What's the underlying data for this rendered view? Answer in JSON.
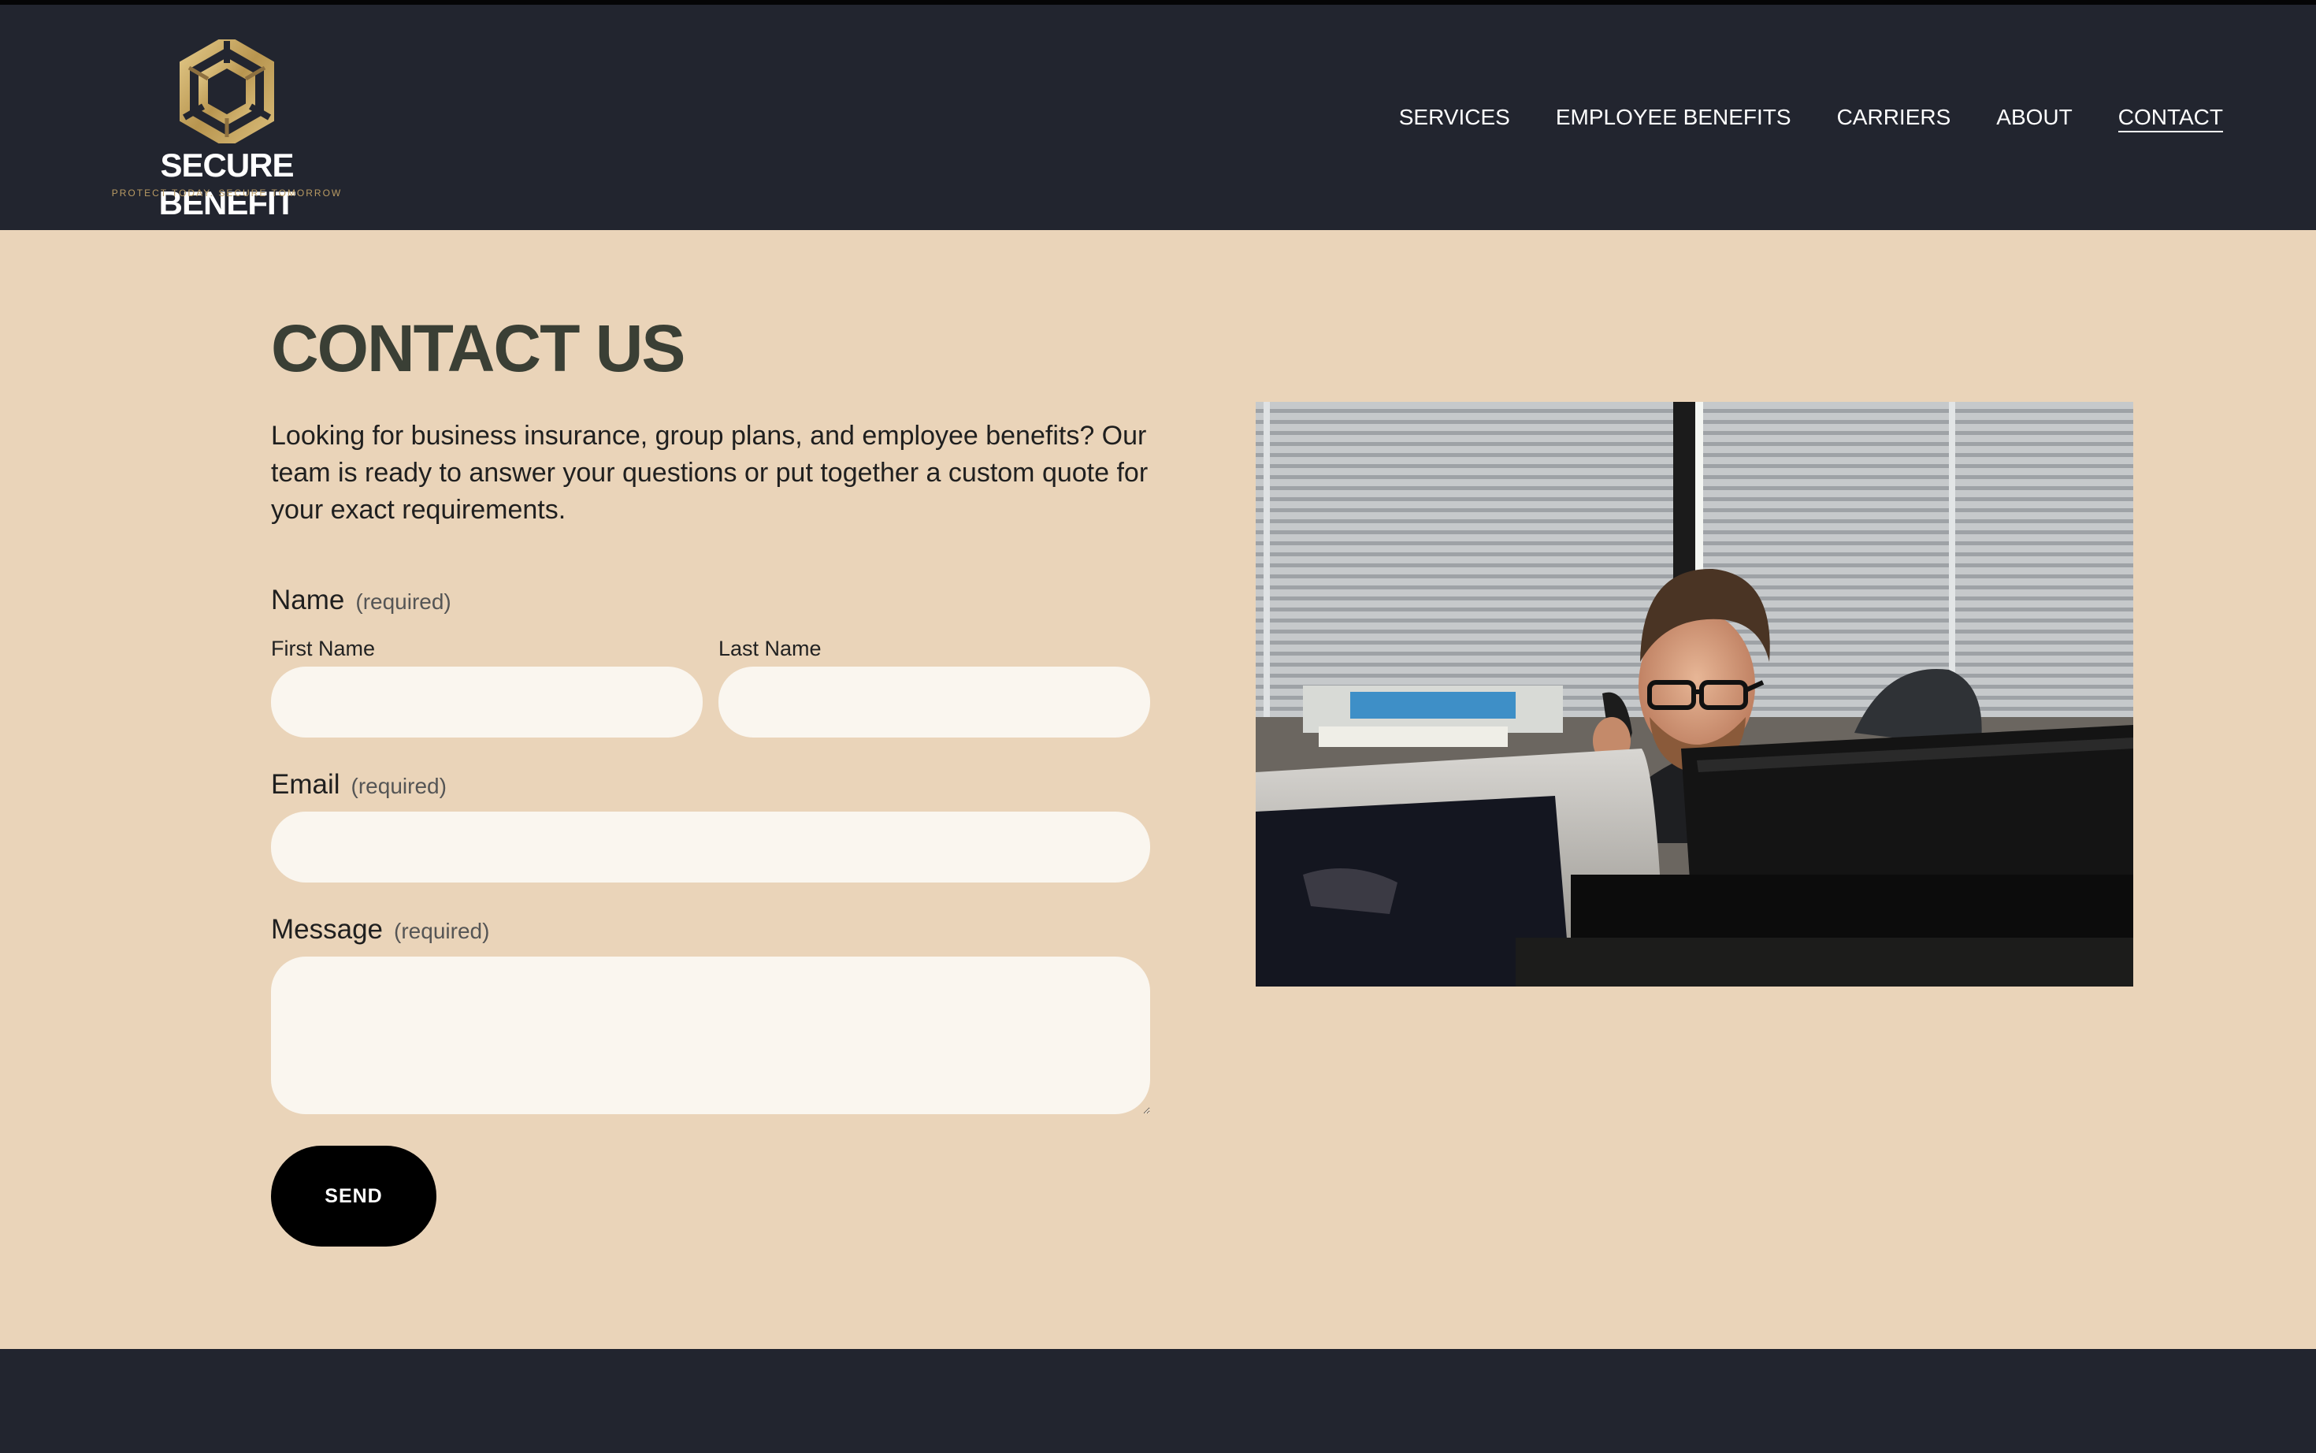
{
  "brand": {
    "name": "SECURE BENEFIT",
    "tagline": "PROTECT TODAY. SECURE TOMORROW",
    "logo_icon": "hexagon-knot-icon",
    "accent_color": "#c9a862"
  },
  "nav": {
    "items": [
      {
        "label": "SERVICES"
      },
      {
        "label": "EMPLOYEE BENEFITS"
      },
      {
        "label": "CARRIERS"
      },
      {
        "label": "ABOUT"
      },
      {
        "label": "CONTACT",
        "active": true
      }
    ]
  },
  "page": {
    "title": "CONTACT US",
    "intro": "Looking for business insurance, group plans, and employee benefits? Our team is ready to answer your questions or put together a custom quote for your exact requirements."
  },
  "form": {
    "name_label": "Name",
    "required_text": "(required)",
    "first_name_label": "First Name",
    "last_name_label": "Last Name",
    "first_name_value": "",
    "last_name_value": "",
    "email_label": "Email",
    "email_value": "",
    "message_label": "Message",
    "message_value": "",
    "submit_label": "SEND"
  },
  "colors": {
    "header_bg": "#22252f",
    "page_bg": "#ead4b9",
    "field_bg": "#faf6ef",
    "title_color": "#3a3f35",
    "button_bg": "#000000"
  }
}
